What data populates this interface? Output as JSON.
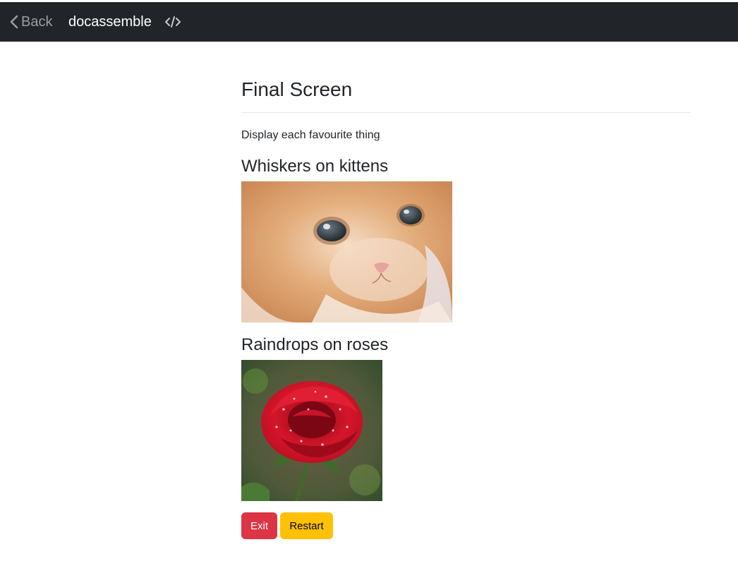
{
  "navbar": {
    "back_label": "Back",
    "brand": "docassemble",
    "back_icon": "chevron-left-icon",
    "source_icon": "code-icon"
  },
  "question": {
    "title": "Final Screen",
    "subquestion": "Display each favourite thing"
  },
  "things": [
    {
      "heading": "Whiskers on kittens",
      "image": "kitten photo"
    },
    {
      "heading": "Raindrops on roses",
      "image": "red rose with raindrops photo"
    }
  ],
  "buttons": {
    "exit_label": "Exit",
    "restart_label": "Restart"
  },
  "colors": {
    "navbar_bg": "#212529",
    "exit_button": "#dc3545",
    "restart_button": "#ffc107"
  }
}
